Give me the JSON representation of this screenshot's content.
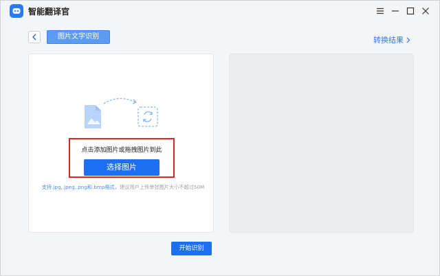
{
  "app": {
    "title": "智能翻译官",
    "logo_icon": "robot-icon",
    "accent": "#1d6ff2"
  },
  "window_controls": [
    "menu-icon",
    "minimize-icon",
    "maximize-icon",
    "close-icon"
  ],
  "toolbar": {
    "back_icon": "chevron-left-icon",
    "active_tab": "图片文字识别",
    "result_link": "转换结果"
  },
  "upload_panel": {
    "hint": "点击添加图片或拖拽图片到此",
    "select_button": "选择图片",
    "support_formats": "支持.jpg,.jpeg,.png和.bmp格式，",
    "support_size": "建议用户上传单张图片大小不超过50M"
  },
  "actions": {
    "start": "开始识别"
  }
}
